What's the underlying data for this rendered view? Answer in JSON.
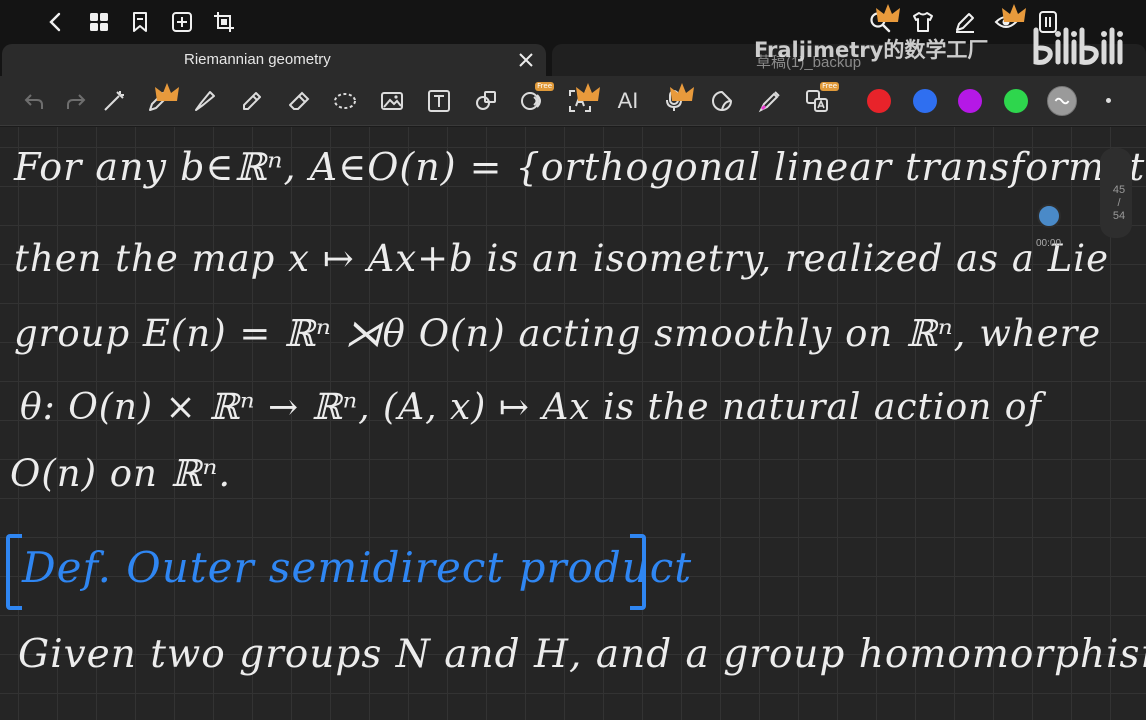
{
  "topbar": {
    "icons": [
      "back-arrow-icon",
      "grid-icon",
      "bookmark-icon",
      "add-icon",
      "crop-icon",
      "search-icon",
      "theme-shirt-icon",
      "sign-pen-icon",
      "eye-icon",
      "book-icon"
    ]
  },
  "tabs": [
    {
      "label": "Riemannian geometry",
      "active": true
    },
    {
      "label": "草稿(1)_backup",
      "active": false
    }
  ],
  "toolbar": {
    "tools": [
      "undo",
      "redo",
      "magic-pen",
      "pen",
      "highlighter-pen",
      "marker",
      "eraser",
      "lasso",
      "image",
      "text",
      "shapes",
      "ocr",
      "text-recognition",
      "ai",
      "voice",
      "sticker",
      "laser-pointer",
      "translate"
    ],
    "ai_label": "AI",
    "free_badge": "Free",
    "colors": [
      "#e8232a",
      "#2f6ff0",
      "#b518e6",
      "#2ed64d"
    ]
  },
  "canvas": {
    "lines": [
      "For any b∈ℝⁿ, A∈O(n) = {orthogonal linear transformation}",
      "then the map x ↦ Ax+b is an isometry, realized as a Lie",
      "group E(n) = ℝⁿ ⋊θ O(n) acting smoothly on ℝⁿ, where",
      "θ: O(n) × ℝⁿ → ℝⁿ, (A, x) ↦ Ax is the natural action of",
      "O(n) on ℝⁿ."
    ],
    "definition_title": "Def. Outer semidirect product",
    "last_line": "Given two groups N and H, and a group homomorphism"
  },
  "scroll": {
    "page_current": "45",
    "page_sep": "/",
    "page_total": "54",
    "time": "00:00"
  },
  "watermark": {
    "text": "Fraljimetry的数学工厂",
    "logo": "bilibili"
  }
}
